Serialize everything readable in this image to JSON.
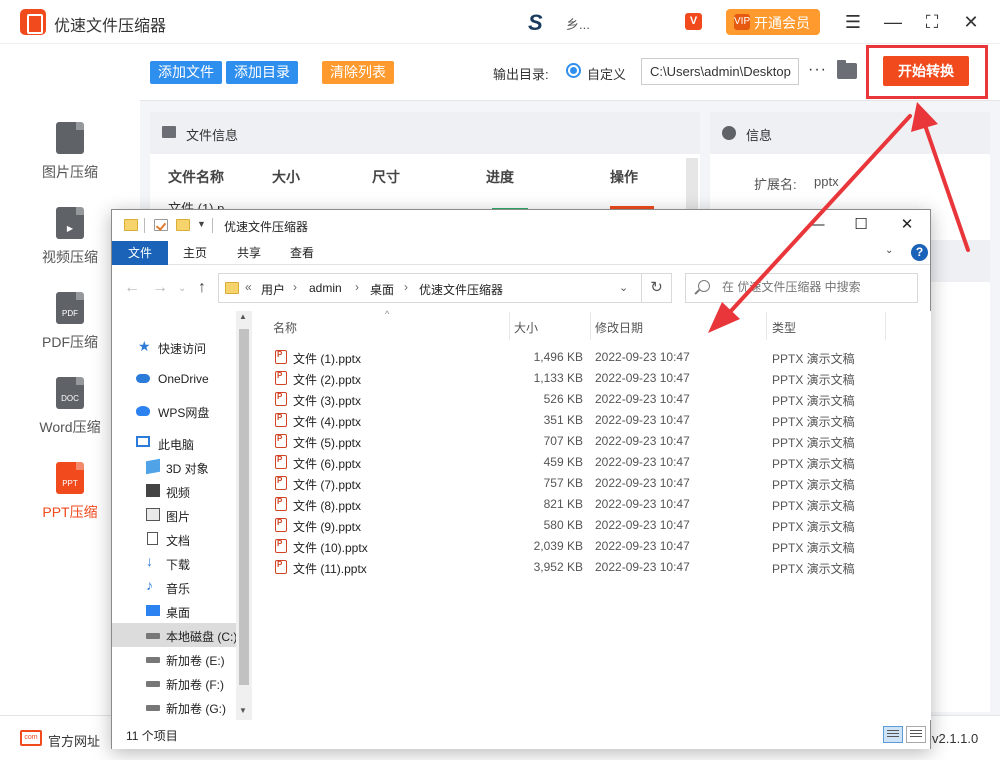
{
  "app": {
    "title": "优速文件压缩器",
    "user_name": "乡...",
    "vip_label": "开通会员",
    "vip_icon_text": "VIP",
    "vip_badge_text": "V",
    "logo_icon": "app-logo-icon",
    "colors": {
      "brand": "#f04a1d",
      "accent": "#2f8fee",
      "vip": "#ff9a2e",
      "highlight": "#e8363a"
    }
  },
  "window_controls": {
    "menu": "☰",
    "minimize": "—",
    "maximize": "⛶",
    "close": "✕"
  },
  "sidebar": {
    "items": [
      {
        "label": "图片压缩",
        "icon": "image-file-icon",
        "icon_text": "",
        "active": false
      },
      {
        "label": "视频压缩",
        "icon": "video-file-icon",
        "icon_text": "▶",
        "active": false
      },
      {
        "label": "PDF压缩",
        "icon": "pdf-file-icon",
        "icon_text": "PDF",
        "active": false
      },
      {
        "label": "Word压缩",
        "icon": "doc-file-icon",
        "icon_text": "DOC",
        "active": false
      },
      {
        "label": "PPT压缩",
        "icon": "ppt-file-icon",
        "icon_text": "PPT",
        "active": true
      }
    ]
  },
  "toolbar": {
    "add_file": "添加文件",
    "add_dir": "添加目录",
    "clear_list": "清除列表",
    "output_label": "输出目录:",
    "custom_label": "自定义",
    "output_path": "C:\\Users\\admin\\Desktop",
    "more_label": "···",
    "start_label": "开始转换"
  },
  "file_panel": {
    "title": "文件信息",
    "columns": [
      "文件名称",
      "大小",
      "尺寸",
      "进度",
      "操作"
    ],
    "first_row_name": "文件 (1).p"
  },
  "info_panel": {
    "title": "信息",
    "ext_label": "扩展名:",
    "ext_value": "pptx"
  },
  "bottom": {
    "site_label": "官方网址",
    "site_icon_text": "com",
    "version": "v2.1.1.0"
  },
  "explorer": {
    "title": "优速文件压缩器",
    "ribbon_tabs": [
      "文件",
      "主页",
      "共享",
      "查看"
    ],
    "active_tab": "文件",
    "help_label": "?",
    "breadcrumb": [
      "用户",
      "admin",
      "桌面",
      "优速文件压缩器"
    ],
    "breadcrumb_prefix": "«",
    "search_placeholder": "在 优速文件压缩器 中搜索",
    "nav": [
      {
        "label": "快速访问",
        "icon": "star-icon"
      },
      {
        "label": "OneDrive",
        "icon": "cloud-icon"
      },
      {
        "label": "WPS网盘",
        "icon": "wps-cloud-icon"
      },
      {
        "label": "此电脑",
        "icon": "pc-icon"
      },
      {
        "label": "3D 对象",
        "icon": "3d-objects-icon"
      },
      {
        "label": "视频",
        "icon": "video-folder-icon"
      },
      {
        "label": "图片",
        "icon": "picture-folder-icon"
      },
      {
        "label": "文档",
        "icon": "document-folder-icon"
      },
      {
        "label": "下载",
        "icon": "download-icon"
      },
      {
        "label": "音乐",
        "icon": "music-icon"
      },
      {
        "label": "桌面",
        "icon": "desktop-icon"
      },
      {
        "label": "本地磁盘 (C:)",
        "icon": "drive-icon",
        "selected": true
      },
      {
        "label": "新加卷 (E:)",
        "icon": "drive-icon"
      },
      {
        "label": "新加卷 (F:)",
        "icon": "drive-icon"
      },
      {
        "label": "新加卷 (G:)",
        "icon": "drive-icon"
      }
    ],
    "columns": {
      "name": "名称",
      "size": "大小",
      "date": "修改日期",
      "type": "类型"
    },
    "files": [
      {
        "name": "文件 (1).pptx",
        "size": "1,496 KB",
        "date": "2022-09-23 10:47",
        "type": "PPTX 演示文稿"
      },
      {
        "name": "文件 (2).pptx",
        "size": "1,133 KB",
        "date": "2022-09-23 10:47",
        "type": "PPTX 演示文稿"
      },
      {
        "name": "文件 (3).pptx",
        "size": "526 KB",
        "date": "2022-09-23 10:47",
        "type": "PPTX 演示文稿"
      },
      {
        "name": "文件 (4).pptx",
        "size": "351 KB",
        "date": "2022-09-23 10:47",
        "type": "PPTX 演示文稿"
      },
      {
        "name": "文件 (5).pptx",
        "size": "707 KB",
        "date": "2022-09-23 10:47",
        "type": "PPTX 演示文稿"
      },
      {
        "name": "文件 (6).pptx",
        "size": "459 KB",
        "date": "2022-09-23 10:47",
        "type": "PPTX 演示文稿"
      },
      {
        "name": "文件 (7).pptx",
        "size": "757 KB",
        "date": "2022-09-23 10:47",
        "type": "PPTX 演示文稿"
      },
      {
        "name": "文件 (8).pptx",
        "size": "821 KB",
        "date": "2022-09-23 10:47",
        "type": "PPTX 演示文稿"
      },
      {
        "name": "文件 (9).pptx",
        "size": "580 KB",
        "date": "2022-09-23 10:47",
        "type": "PPTX 演示文稿"
      },
      {
        "name": "文件 (10).pptx",
        "size": "2,039 KB",
        "date": "2022-09-23 10:47",
        "type": "PPTX 演示文稿"
      },
      {
        "name": "文件 (11).pptx",
        "size": "3,952 KB",
        "date": "2022-09-23 10:47",
        "type": "PPTX 演示文稿"
      }
    ],
    "status_count": "11 个项目"
  }
}
